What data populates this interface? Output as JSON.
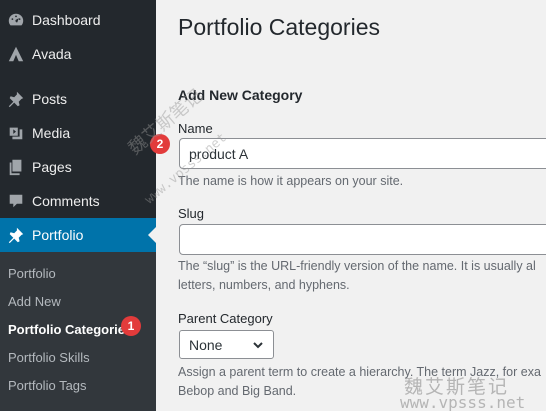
{
  "sidebar": {
    "items": [
      {
        "label": "Dashboard",
        "icon": "dashboard-icon"
      },
      {
        "label": "Avada",
        "icon": "avada-icon"
      },
      {
        "label": "Posts",
        "icon": "pushpin-icon"
      },
      {
        "label": "Media",
        "icon": "media-icon"
      },
      {
        "label": "Pages",
        "icon": "pages-icon"
      },
      {
        "label": "Comments",
        "icon": "comment-icon"
      },
      {
        "label": "Portfolio",
        "icon": "pushpin-icon",
        "active": true
      }
    ],
    "submenu": [
      {
        "label": "Portfolio"
      },
      {
        "label": "Add New"
      },
      {
        "label": "Portfolio Categories",
        "current": true
      },
      {
        "label": "Portfolio Skills"
      },
      {
        "label": "Portfolio Tags"
      }
    ],
    "badge": "1"
  },
  "main": {
    "title": "Portfolio Categories",
    "section_title": "Add New Category",
    "name": {
      "label": "Name",
      "value": "product A",
      "description": "The name is how it appears on your site.",
      "badge": "2"
    },
    "slug": {
      "label": "Slug",
      "value": "",
      "description_line1": "The “slug” is the URL-friendly version of the name. It is usually al",
      "description_line2": "letters, numbers, and hyphens."
    },
    "parent": {
      "label": "Parent Category",
      "selected": "None",
      "description_line1": "Assign a parent term to create a hierarchy. The term Jazz, for exa",
      "description_line2": "Bebop and Big Band."
    }
  },
  "watermark": {
    "cn": "魏艾斯笔记",
    "url": "www.vpsss.net"
  },
  "colors": {
    "sidebar_bg": "#23282d",
    "submenu_bg": "#32373c",
    "accent": "#0073aa",
    "badge": "#e23b3b"
  }
}
